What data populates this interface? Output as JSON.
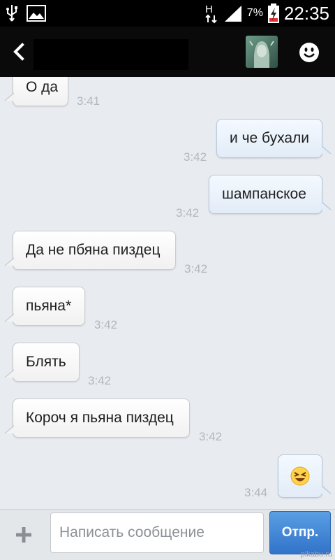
{
  "status_bar": {
    "network": "H",
    "battery_percent": "7%",
    "time": "22:35",
    "icons": [
      "usb-icon",
      "image-icon",
      "data-arrows-icon",
      "signal-icon",
      "battery-charging-icon"
    ]
  },
  "header": {
    "back_icon": "chevron-left-icon",
    "contact_name": "",
    "avatar_icon": "contact-avatar",
    "emoji_icon": "smiley-icon"
  },
  "messages": [
    {
      "direction": "in",
      "text": "О да",
      "time": "3:41"
    },
    {
      "direction": "out",
      "text": "и че бухали",
      "time": "3:42"
    },
    {
      "direction": "out",
      "text": "шампанское",
      "time": "3:42"
    },
    {
      "direction": "in",
      "text": "Да не пбяна пиздец",
      "time": "3:42"
    },
    {
      "direction": "in",
      "text": "пьяна*",
      "time": "3:42"
    },
    {
      "direction": "in",
      "text": "Блять",
      "time": "3:42"
    },
    {
      "direction": "in",
      "text": "Короч я пьяна пиздец",
      "time": "3:42"
    },
    {
      "direction": "out",
      "text": "😆",
      "time": "3:44"
    }
  ],
  "composer": {
    "attach_icon": "plus-icon",
    "placeholder": "Написать сообщение",
    "value": "",
    "send_label": "Отпр."
  },
  "watermark": "pikabu.ru"
}
